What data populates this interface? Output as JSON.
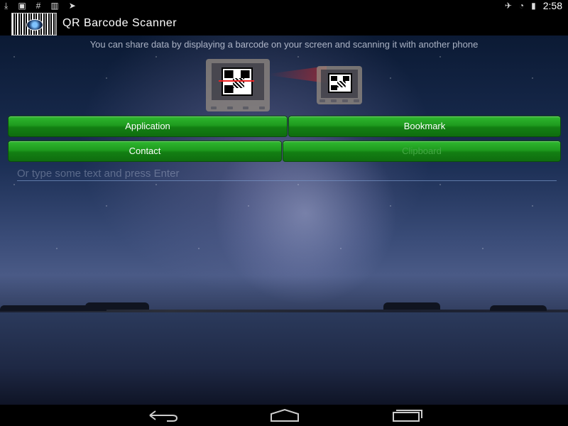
{
  "status_bar": {
    "left_icons": [
      "download-icon",
      "image-icon",
      "hash-icon",
      "barcode-icon",
      "send-icon"
    ],
    "right_icons": [
      "mute-icon",
      "wifi-icon",
      "battery-charging-icon"
    ],
    "time": "2:58"
  },
  "app": {
    "title": "QR Barcode Scanner",
    "icon": "qr-scanner-app-icon"
  },
  "main": {
    "info_text": "You can share data by displaying a barcode on your screen and scanning it with another phone",
    "buttons": {
      "application": "Application",
      "bookmark": "Bookmark",
      "contact": "Contact",
      "clipboard": "Clipboard"
    },
    "clipboard_enabled": false,
    "text_input": {
      "placeholder": "Or type some text and press Enter",
      "value": ""
    }
  },
  "nav_bar": {
    "buttons": [
      "back-icon",
      "home-icon",
      "recent-apps-icon"
    ]
  },
  "colors": {
    "button_green": "#1e9a1e",
    "button_border": "#0a4e0a",
    "scan_beam": "#e22"
  }
}
